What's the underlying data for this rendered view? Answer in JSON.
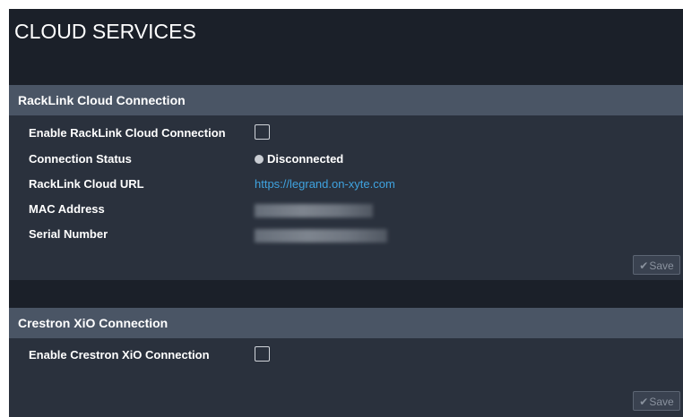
{
  "page": {
    "title": "CLOUD SERVICES"
  },
  "racklink": {
    "header": "RackLink Cloud Connection",
    "enable_label": "Enable RackLink Cloud Connection",
    "status_label": "Connection Status",
    "status_value": "Disconnected",
    "url_label": "RackLink Cloud URL",
    "url_value": "https://legrand.on-xyte.com",
    "mac_label": "MAC Address",
    "serial_label": "Serial Number",
    "save_label": "Save"
  },
  "crestron": {
    "header": "Crestron XiO Connection",
    "enable_label": "Enable Crestron XiO Connection",
    "save_label": "Save"
  },
  "colors": {
    "background": "#1b2029",
    "panel": "#2a313d",
    "panel_header": "#4a5565",
    "link": "#3fa3e0"
  },
  "icons": {
    "status": "status-dot-icon",
    "save": "check-icon"
  }
}
